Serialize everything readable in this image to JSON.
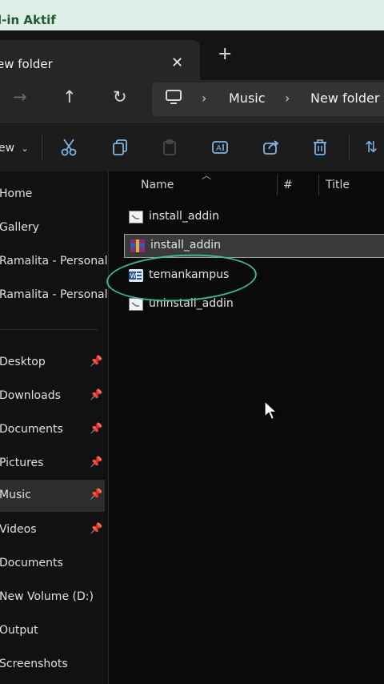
{
  "banner": {
    "text": "l-in Aktif"
  },
  "tab": {
    "title": "ew folder",
    "close_icon": "close-icon",
    "new_tab_icon": "plus-icon"
  },
  "address": {
    "back_icon": "arrow-left-icon",
    "forward_icon": "arrow-right-icon",
    "up_icon": "arrow-up-icon",
    "refresh_icon": "refresh-icon",
    "breadcrumbs": [
      "Music",
      "New folder"
    ]
  },
  "toolbar": {
    "new_label": "ew",
    "icons": [
      "cut-icon",
      "copy-icon",
      "paste-icon",
      "rename-icon",
      "share-icon",
      "delete-icon",
      "sort-icon"
    ]
  },
  "sidebar": {
    "items": [
      {
        "label": "Home"
      },
      {
        "label": "Gallery"
      },
      {
        "label": "Ramalita - Personal"
      },
      {
        "label": "Ramalita - Personal"
      },
      {
        "label": "Desktop",
        "pinned": true
      },
      {
        "label": "Downloads",
        "pinned": true
      },
      {
        "label": "Documents",
        "pinned": true
      },
      {
        "label": "Pictures",
        "pinned": true
      },
      {
        "label": "Music",
        "pinned": true,
        "selected": true
      },
      {
        "label": "Videos",
        "pinned": true
      },
      {
        "label": "Documents"
      },
      {
        "label": "New Volume (D:)"
      },
      {
        "label": "Output"
      },
      {
        "label": "Screenshots"
      }
    ]
  },
  "columns": {
    "name": "Name",
    "number": "#",
    "title": "Title"
  },
  "files": [
    {
      "name": "install_addin",
      "icon": "script-file-icon"
    },
    {
      "name": "install_addin",
      "icon": "archive-file-icon",
      "selected": true
    },
    {
      "name": "temankampus",
      "icon": "word-addin-file-icon"
    },
    {
      "name": "uninstall_addin",
      "icon": "script-file-icon"
    }
  ],
  "colors": {
    "accent": "#7fb5e5",
    "annotation": "#3fb59d",
    "banner_bg": "#dfeee6",
    "banner_text": "#1f5a31"
  }
}
